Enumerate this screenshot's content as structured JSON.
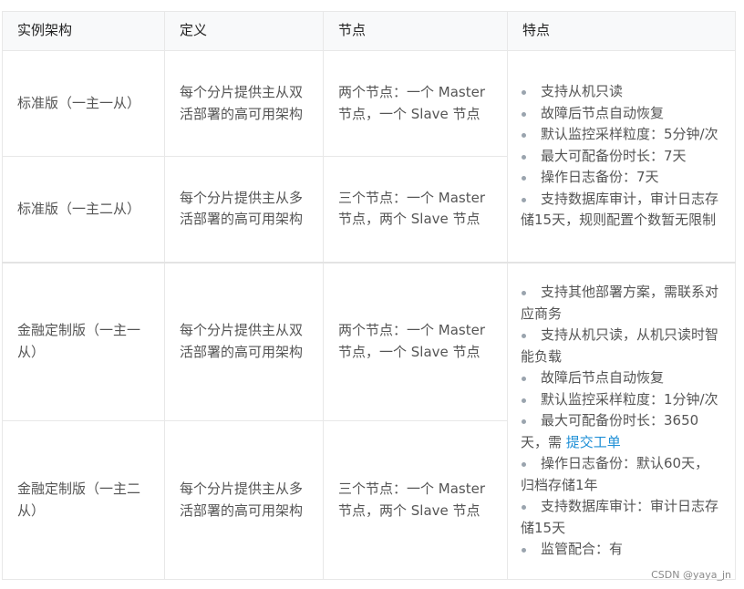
{
  "headers": [
    "实例架构",
    "定义",
    "节点",
    "特点"
  ],
  "rows": [
    {
      "arch": "标准版（一主一从）",
      "def": "每个分片提供主从双活部署的高可用架构",
      "nodes": "两个节点：一个 Master 节点，一个 Slave 节点"
    },
    {
      "arch": "标准版（一主二从）",
      "def": "每个分片提供主从多活部署的高可用架构",
      "nodes": "三个节点：一个 Master 节点，两个 Slave 节点"
    },
    {
      "arch": "金融定制版（一主一从）",
      "def": "每个分片提供主从双活部署的高可用架构",
      "nodes": "两个节点：一个 Master 节点，一个 Slave 节点"
    },
    {
      "arch": "金融定制版（一主二从）",
      "def": "每个分片提供主从多活部署的高可用架构",
      "nodes": "三个节点：一个 Master 节点，两个 Slave 节点"
    }
  ],
  "features_standard": [
    "支持从机只读",
    "故障后节点自动恢复",
    "默认监控采样粒度：5分钟/次",
    "最大可配备份时长：7天",
    "操作日志备份：7天",
    "支持数据库审计，审计日志存储15天，规则配置个数暂无限制"
  ],
  "features_finance": {
    "items": [
      "支持其他部署方案，需联系对应商务",
      "支持从机只读，从机只读时智能负载",
      "故障后节点自动恢复",
      "默认监控采样粒度：1分钟/次"
    ],
    "backup_prefix": "最大可配备份时长：3650天，需 ",
    "backup_link": "提交工单",
    "items_after": [
      "操作日志备份：默认60天，归档存储1年",
      "支持数据库审计：审计日志存储15天",
      "监管配合：有"
    ]
  },
  "watermark": "CSDN @yaya_jn",
  "colors": {
    "header_bg": "#f8f9fa",
    "border": "#e8e8e8",
    "link": "#1e8fd6",
    "bullet": "#9aa4ae"
  }
}
